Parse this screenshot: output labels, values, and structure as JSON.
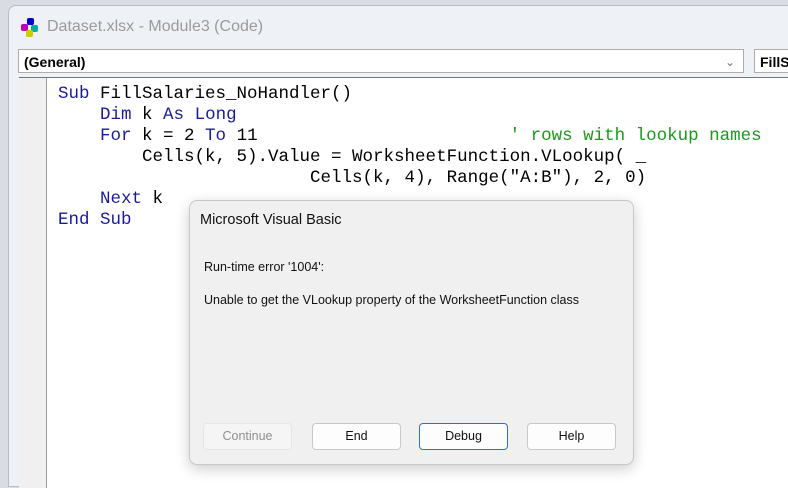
{
  "window": {
    "title": "Dataset.xlsx - Module3 (Code)",
    "icon": "vba-project-icon"
  },
  "object_combo": {
    "value": "(General)"
  },
  "procedure_combo": {
    "value": "FillS"
  },
  "code": {
    "l1": {
      "kw": "Sub",
      "rest": " FillSalaries_NoHandler()"
    },
    "l2": {
      "kw1": "Dim",
      "mid": " k ",
      "kw2": "As",
      "kw3": "Long"
    },
    "l3": {
      "kw1": "For",
      "mid": " k = 2 ",
      "kw2": "To",
      "rest": " 11",
      "comment": "' rows with lookup names"
    },
    "l4": "Cells(k, 5).Value = WorksheetFunction.VLookup( _",
    "l5": "Cells(k, 4), Range(\"A:B\"), 2, 0)",
    "l6": {
      "kw": "Next",
      "rest": " k"
    },
    "l7": {
      "kw1": "End",
      "kw2": "Sub"
    }
  },
  "dialog": {
    "title": "Microsoft Visual Basic",
    "error": "Run-time error '1004':",
    "message": "Unable to get the VLookup property of the WorksheetFunction class",
    "buttons": {
      "continue": "Continue",
      "end": "End",
      "debug": "Debug",
      "help": "Help"
    }
  }
}
